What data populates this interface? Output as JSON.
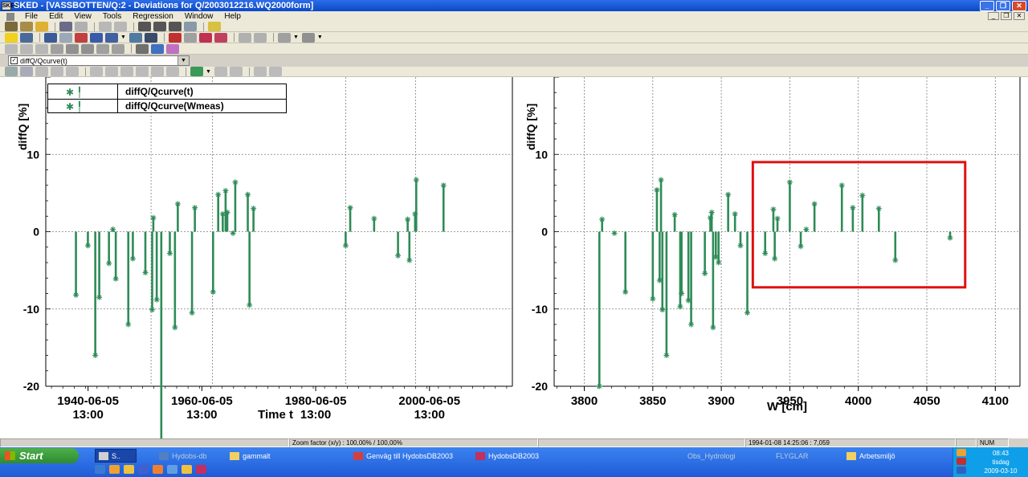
{
  "window": {
    "title": "SKED - [VASSBOTTEN/Q:2 - Deviations for Q/2003012216.WQ2000form]",
    "app_icon_label": "SKED"
  },
  "menu": [
    "File",
    "Edit",
    "View",
    "Tools",
    "Regression",
    "Window",
    "Help"
  ],
  "series_selector": {
    "value": "diffQ/Qcurve(t)"
  },
  "legend": [
    "diffQ/Qcurve(t)",
    "diffQ/Qcurve(Wmeas)"
  ],
  "colors": {
    "series": "#2e8b57",
    "highlight": "#e01010",
    "grid": "#7f7f7f"
  },
  "chart_data": [
    {
      "type": "bar",
      "ylabel": "diffQ [%]",
      "xlabel": "Time t",
      "ylim": [
        -20,
        20
      ],
      "yticks": [
        10,
        0,
        -10,
        -20
      ],
      "xticks": [
        {
          "line1": "1940-06-05",
          "line2": "13:00"
        },
        {
          "line1": "1960-06-05",
          "line2": "13:00"
        },
        {
          "line1": "1980-06-05",
          "line2": "13:00"
        },
        {
          "line1": "2000-06-05",
          "line2": "13:00"
        }
      ],
      "grid": true,
      "legend_position": "top-left",
      "x_range_years": [
        1933,
        2015
      ],
      "points": [
        {
          "x": 1938.3,
          "y": -8.2
        },
        {
          "x": 1940.4,
          "y": -1.8
        },
        {
          "x": 1941.7,
          "y": -16
        },
        {
          "x": 1942.4,
          "y": -8.5
        },
        {
          "x": 1944.1,
          "y": -4.1
        },
        {
          "x": 1944.8,
          "y": 0.3
        },
        {
          "x": 1945.3,
          "y": -6.1
        },
        {
          "x": 1947.5,
          "y": -12
        },
        {
          "x": 1948.3,
          "y": -3.5
        },
        {
          "x": 1950.5,
          "y": -5.3
        },
        {
          "x": 1951.7,
          "y": -10.1
        },
        {
          "x": 1951.9,
          "y": 1.8
        },
        {
          "x": 1952.5,
          "y": -8.8
        },
        {
          "x": 1953.3,
          "y": -28
        },
        {
          "x": 1954.8,
          "y": -2.8
        },
        {
          "x": 1955.7,
          "y": -12.4
        },
        {
          "x": 1956.2,
          "y": 3.6
        },
        {
          "x": 1958.7,
          "y": -10.5
        },
        {
          "x": 1959.2,
          "y": 3.1
        },
        {
          "x": 1962.4,
          "y": -7.8
        },
        {
          "x": 1963.3,
          "y": 4.8
        },
        {
          "x": 1964.1,
          "y": 2.3
        },
        {
          "x": 1964.6,
          "y": 5.3
        },
        {
          "x": 1964.9,
          "y": 2.5
        },
        {
          "x": 1965.9,
          "y": -0.2
        },
        {
          "x": 1966.3,
          "y": 6.4
        },
        {
          "x": 1968.5,
          "y": 4.8
        },
        {
          "x": 1968.8,
          "y": -9.5
        },
        {
          "x": 1969.5,
          "y": 3.0
        },
        {
          "x": 1985.7,
          "y": -1.8
        },
        {
          "x": 1986.5,
          "y": 3.1
        },
        {
          "x": 1990.7,
          "y": 1.7
        },
        {
          "x": 1994.9,
          "y": -3.1
        },
        {
          "x": 1996.6,
          "y": 1.6
        },
        {
          "x": 1996.9,
          "y": -3.7
        },
        {
          "x": 1997.9,
          "y": 2.3
        },
        {
          "x": 1998.1,
          "y": 6.7
        },
        {
          "x": 2002.9,
          "y": 6.0
        }
      ]
    },
    {
      "type": "bar",
      "ylabel": "diffQ [%]",
      "xlabel": "W [cm]",
      "ylim": [
        -20,
        20
      ],
      "yticks": [
        10,
        0,
        -10,
        -20
      ],
      "xticks": [
        3800,
        3850,
        3900,
        3950,
        4000,
        4050,
        4100
      ],
      "xlim": [
        3778,
        4118
      ],
      "grid": true,
      "points": [
        {
          "x": 3811,
          "y": -20
        },
        {
          "x": 3813,
          "y": 1.6
        },
        {
          "x": 3822,
          "y": -0.2
        },
        {
          "x": 3830,
          "y": -7.8
        },
        {
          "x": 3850,
          "y": -8.7
        },
        {
          "x": 3853,
          "y": 5.4
        },
        {
          "x": 3855,
          "y": -6.3
        },
        {
          "x": 3856,
          "y": 6.7
        },
        {
          "x": 3857,
          "y": -10.1
        },
        {
          "x": 3860,
          "y": -16
        },
        {
          "x": 3866,
          "y": 2.2
        },
        {
          "x": 3870,
          "y": -9.7
        },
        {
          "x": 3871,
          "y": -8.0
        },
        {
          "x": 3876,
          "y": -8.9
        },
        {
          "x": 3878,
          "y": -12
        },
        {
          "x": 3888,
          "y": -5.4
        },
        {
          "x": 3892,
          "y": 1.8
        },
        {
          "x": 3893,
          "y": 2.5
        },
        {
          "x": 3894,
          "y": -12.4
        },
        {
          "x": 3896,
          "y": -3.3
        },
        {
          "x": 3898,
          "y": -4.0
        },
        {
          "x": 3905,
          "y": 4.8
        },
        {
          "x": 3910,
          "y": 2.3
        },
        {
          "x": 3914,
          "y": -1.8
        },
        {
          "x": 3919,
          "y": -10.5
        },
        {
          "x": 3932,
          "y": -2.8
        },
        {
          "x": 3938,
          "y": 2.9
        },
        {
          "x": 3939,
          "y": -3.5
        },
        {
          "x": 3941,
          "y": 1.7
        },
        {
          "x": 3950,
          "y": 6.4
        },
        {
          "x": 3958,
          "y": -1.9
        },
        {
          "x": 3962,
          "y": 0.3
        },
        {
          "x": 3968,
          "y": 3.6
        },
        {
          "x": 3988,
          "y": 6.0
        },
        {
          "x": 3996,
          "y": 3.1
        },
        {
          "x": 4003,
          "y": 4.7
        },
        {
          "x": 4015,
          "y": 3.0
        },
        {
          "x": 4027,
          "y": -3.7
        },
        {
          "x": 4067,
          "y": -0.8
        }
      ],
      "highlight_box": {
        "x": [
          3923,
          4078
        ],
        "y": [
          -7.2,
          9.0
        ]
      }
    }
  ],
  "status": {
    "zoom": "Zoom factor (x/y) :   100,00% / 100,00%",
    "cursor": "1994-01-08 14:25:06 : 7,059",
    "num": "NUM"
  },
  "taskbar": {
    "start": "Start",
    "tasks": [
      "S..",
      "Hydobs-db",
      "gammalt",
      "Genväg till HydobsDB2003",
      "HydobsDB2003",
      "Obs_Hydrologi",
      "FLYGLAR",
      "Arbetsmiljö"
    ],
    "time": "08:43",
    "day": "tisdag",
    "date": "2009-03-10"
  }
}
